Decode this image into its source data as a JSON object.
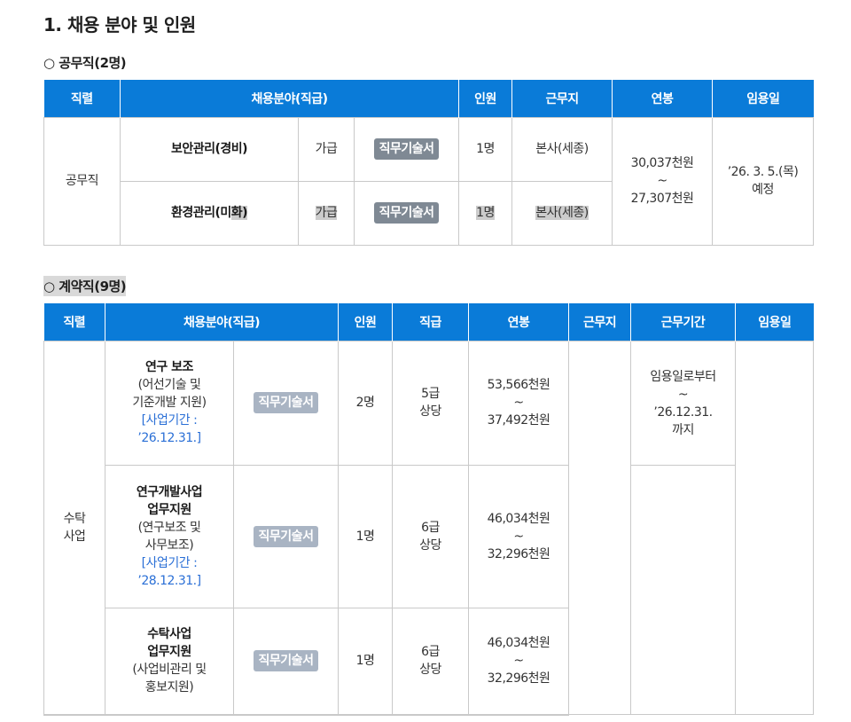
{
  "section_title": "1. 채용 분야 및 인원",
  "public": {
    "heading": "○ 공무직(2명)",
    "headers": [
      "직렬",
      "채용분야(직급)",
      "인원",
      "근무지",
      "연봉",
      "임용일"
    ],
    "series": "공무직",
    "rows": [
      {
        "field": "보안관리(경비)",
        "grade": "가급",
        "doc": "직무기술서",
        "count": "1명",
        "place": "본사(세종)"
      },
      {
        "field_a": "환경관리(미",
        "field_b": "화)",
        "grade": "가급",
        "doc": "직무기술서",
        "count": "1명",
        "place": "본사(세종)"
      }
    ],
    "salary": [
      "30,037천원",
      "~",
      "27,307천원"
    ],
    "start": [
      "’26. 3. 5.(목)",
      "예정"
    ]
  },
  "contract": {
    "heading": "○ 계약직(9명)",
    "headers": [
      "직렬",
      "채용분야(직급)",
      "인원",
      "직급",
      "연봉",
      "근무지",
      "근무기간",
      "임용일"
    ],
    "series": [
      "수탁",
      "사업"
    ],
    "rows": [
      {
        "title": [
          "연구 보조"
        ],
        "desc": [
          "(어선기술 및",
          "기준개발 지원)"
        ],
        "period": [
          "[사업기간 :",
          "’26.12.31.]"
        ],
        "doc": "직무기술서",
        "count": "2명",
        "rank": [
          "5급",
          "상당"
        ],
        "salary": [
          "53,566천원",
          "~",
          "37,492천원"
        ],
        "term": [
          "임용일로부터",
          "~",
          "’26.12.31.",
          "까지"
        ]
      },
      {
        "title": [
          "연구개발사업",
          "업무지원"
        ],
        "desc": [
          "(연구보조 및",
          "사무보조)"
        ],
        "period": [
          "[사업기간 :",
          "’28.12.31.]"
        ],
        "doc": "직무기술서",
        "count": "1명",
        "rank": [
          "6급",
          "상당"
        ],
        "salary": [
          "46,034천원",
          "~",
          "32,296천원"
        ]
      },
      {
        "title": [
          "수탁사업",
          "업무지원"
        ],
        "desc": [
          "(사업비관리 및",
          "홍보지원)"
        ],
        "doc": "직무기술서",
        "count": "1명",
        "rank": [
          "6급",
          "상당"
        ],
        "salary": [
          "46,034천원",
          "~",
          "32,296천원"
        ]
      }
    ]
  }
}
